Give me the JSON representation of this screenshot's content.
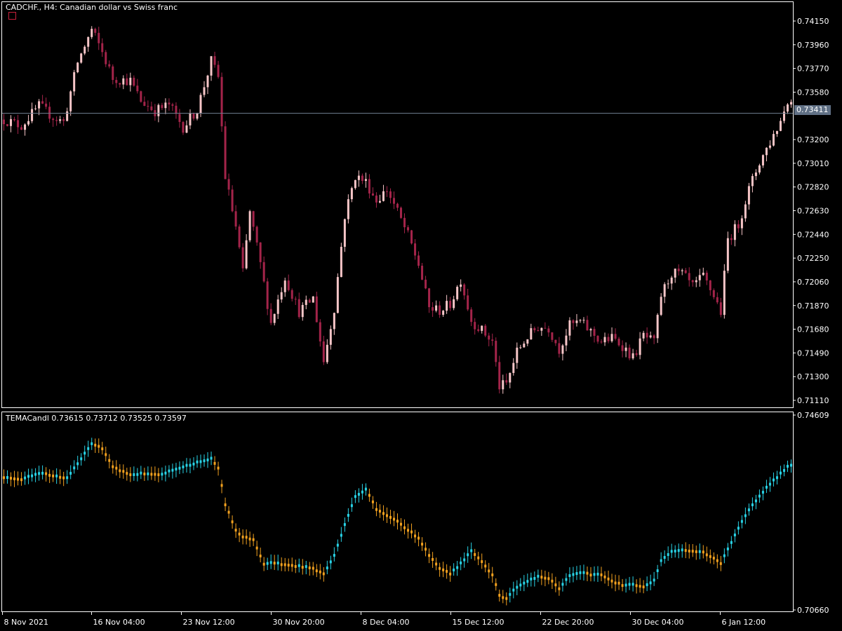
{
  "main_pane": {
    "header": "CADCHF., H4:  Canadian dollar vs Swiss franc",
    "current_price": "0.73411"
  },
  "indicator_pane": {
    "header": "TEMACandl 0.73615 0.73712 0.73525 0.73597"
  },
  "colors": {
    "background": "#000000",
    "axis": "#ffffff",
    "candle_bull": "#f7c6c8",
    "candle_bear": "#a4244a",
    "tema_up": "#28d3e6",
    "tema_down": "#f2a11f",
    "price_line": "#6c7a8c"
  },
  "chart_data": [
    {
      "type": "candlestick",
      "title": "CADCHF., H4:  Canadian dollar vs Swiss franc",
      "y_ticks": [
        "0.74150",
        "0.73960",
        "0.73770",
        "0.73580",
        "0.73200",
        "0.73010",
        "0.72820",
        "0.72630",
        "0.72440",
        "0.72250",
        "0.72060",
        "0.71870",
        "0.71680",
        "0.71490",
        "0.71300",
        "0.71110"
      ],
      "ylim": [
        0.7096,
        0.7429
      ],
      "x_ticks": [
        "8 Nov 2021",
        "16 Nov 04:00",
        "23 Nov 12:00",
        "30 Nov 20:00",
        "8 Dec 04:00",
        "15 Dec 12:00",
        "22 Dec 20:00",
        "30 Dec 04:00",
        "6 Jan 12:00"
      ],
      "current_price": 0.73411,
      "close_path": [
        [
          0,
          0.7336
        ],
        [
          5,
          0.7331
        ],
        [
          10,
          0.7347
        ],
        [
          14,
          0.7338
        ],
        [
          17,
          0.7334
        ],
        [
          21,
          0.7382
        ],
        [
          25,
          0.7408
        ],
        [
          28,
          0.739
        ],
        [
          31,
          0.7369
        ],
        [
          36,
          0.7367
        ],
        [
          39,
          0.7351
        ],
        [
          43,
          0.7343
        ],
        [
          47,
          0.7348
        ],
        [
          51,
          0.733
        ],
        [
          55,
          0.7344
        ],
        [
          59,
          0.7383
        ],
        [
          61,
          0.737
        ],
        [
          63,
          0.729
        ],
        [
          66,
          0.725
        ],
        [
          68,
          0.7213
        ],
        [
          70,
          0.7262
        ],
        [
          73,
          0.722
        ],
        [
          76,
          0.7173
        ],
        [
          80,
          0.721
        ],
        [
          84,
          0.7182
        ],
        [
          88,
          0.7193
        ],
        [
          91,
          0.7142
        ],
        [
          94,
          0.7185
        ],
        [
          97,
          0.7259
        ],
        [
          100,
          0.7291
        ],
        [
          103,
          0.7286
        ],
        [
          106,
          0.7271
        ],
        [
          109,
          0.728
        ],
        [
          112,
          0.7262
        ],
        [
          115,
          0.7243
        ],
        [
          118,
          0.722
        ],
        [
          121,
          0.7185
        ],
        [
          124,
          0.7183
        ],
        [
          127,
          0.7188
        ],
        [
          130,
          0.7208
        ],
        [
          133,
          0.7175
        ],
        [
          136,
          0.7167
        ],
        [
          139,
          0.7158
        ],
        [
          141,
          0.7122
        ],
        [
          143,
          0.7124
        ],
        [
          146,
          0.715
        ],
        [
          149,
          0.7162
        ],
        [
          152,
          0.717
        ],
        [
          155,
          0.7169
        ],
        [
          158,
          0.7152
        ],
        [
          161,
          0.7171
        ],
        [
          164,
          0.7174
        ],
        [
          167,
          0.7166
        ],
        [
          170,
          0.7158
        ],
        [
          173,
          0.7161
        ],
        [
          176,
          0.7155
        ],
        [
          179,
          0.7145
        ],
        [
          182,
          0.7163
        ],
        [
          185,
          0.7157
        ],
        [
          187,
          0.7195
        ],
        [
          190,
          0.7213
        ],
        [
          193,
          0.7212
        ],
        [
          196,
          0.7202
        ],
        [
          199,
          0.721
        ],
        [
          202,
          0.7195
        ],
        [
          204,
          0.7182
        ],
        [
          206,
          0.724
        ],
        [
          209,
          0.7252
        ],
        [
          212,
          0.728
        ],
        [
          215,
          0.7302
        ],
        [
          218,
          0.7318
        ],
        [
          221,
          0.7335
        ],
        [
          223,
          0.7352
        ],
        [
          224,
          0.735
        ]
      ]
    },
    {
      "type": "candlestick",
      "title": "TEMACandl 0.73615 0.73712 0.73525 0.73597",
      "y_ticks": [
        "0.74609",
        "0.70660"
      ],
      "ylim": [
        0.7066,
        0.74609
      ],
      "close_path": [
        [
          0,
          0.7335
        ],
        [
          5,
          0.7331
        ],
        [
          10,
          0.7344
        ],
        [
          14,
          0.7338
        ],
        [
          18,
          0.7334
        ],
        [
          21,
          0.7362
        ],
        [
          25,
          0.7403
        ],
        [
          28,
          0.7394
        ],
        [
          31,
          0.7355
        ],
        [
          36,
          0.734
        ],
        [
          39,
          0.7342
        ],
        [
          44,
          0.7339
        ],
        [
          48,
          0.7349
        ],
        [
          54,
          0.7363
        ],
        [
          59,
          0.7372
        ],
        [
          61,
          0.7354
        ],
        [
          63,
          0.728
        ],
        [
          66,
          0.7228
        ],
        [
          68,
          0.7214
        ],
        [
          71,
          0.7209
        ],
        [
          74,
          0.716
        ],
        [
          77,
          0.7162
        ],
        [
          80,
          0.7157
        ],
        [
          84,
          0.7155
        ],
        [
          88,
          0.715
        ],
        [
          91,
          0.7139
        ],
        [
          94,
          0.7176
        ],
        [
          97,
          0.724
        ],
        [
          100,
          0.7295
        ],
        [
          103,
          0.7312
        ],
        [
          106,
          0.7271
        ],
        [
          109,
          0.7256
        ],
        [
          112,
          0.7246
        ],
        [
          115,
          0.7228
        ],
        [
          118,
          0.7212
        ],
        [
          121,
          0.7176
        ],
        [
          124,
          0.7149
        ],
        [
          127,
          0.714
        ],
        [
          130,
          0.716
        ],
        [
          133,
          0.7185
        ],
        [
          136,
          0.7165
        ],
        [
          139,
          0.7137
        ],
        [
          141,
          0.7095
        ],
        [
          143,
          0.709
        ],
        [
          146,
          0.7113
        ],
        [
          149,
          0.7125
        ],
        [
          152,
          0.7133
        ],
        [
          155,
          0.713
        ],
        [
          158,
          0.711
        ],
        [
          161,
          0.7135
        ],
        [
          164,
          0.7142
        ],
        [
          167,
          0.7138
        ],
        [
          170,
          0.7138
        ],
        [
          173,
          0.7125
        ],
        [
          176,
          0.7116
        ],
        [
          179,
          0.7117
        ],
        [
          182,
          0.7112
        ],
        [
          185,
          0.7127
        ],
        [
          187,
          0.7165
        ],
        [
          190,
          0.7186
        ],
        [
          193,
          0.7188
        ],
        [
          196,
          0.7185
        ],
        [
          199,
          0.7183
        ],
        [
          202,
          0.717
        ],
        [
          204,
          0.716
        ],
        [
          206,
          0.719
        ],
        [
          209,
          0.7232
        ],
        [
          212,
          0.7268
        ],
        [
          215,
          0.7298
        ],
        [
          218,
          0.7322
        ],
        [
          221,
          0.7342
        ],
        [
          223,
          0.7356
        ],
        [
          224,
          0.7358
        ]
      ]
    }
  ]
}
